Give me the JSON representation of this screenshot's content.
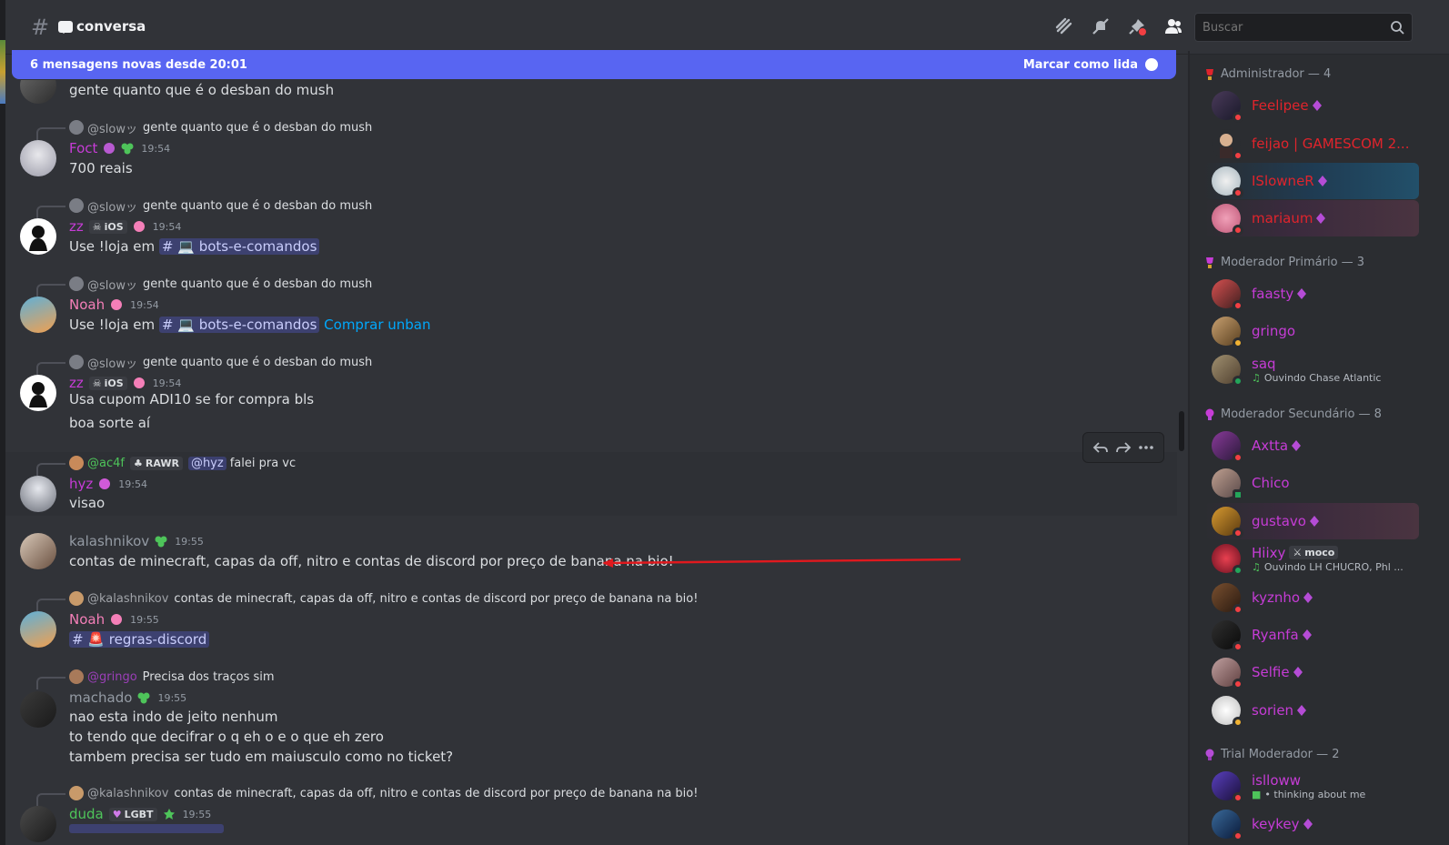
{
  "header": {
    "channel": "conversa",
    "search_placeholder": "Buscar"
  },
  "newbar": {
    "text": "6 mensagens novas desde 20:01",
    "mark_label": "Marcar como lida"
  },
  "messages": {
    "m0": {
      "text": "gente quanto que é o desban do mush"
    },
    "m1": {
      "reply_name": "@slowッ",
      "reply_text": "gente quanto que é o desban do mush",
      "user": "Foct",
      "time": "19:54",
      "text": "700 reais"
    },
    "m2": {
      "reply_name": "@slowッ",
      "reply_text": "gente quanto que é o desban do mush",
      "user": "zz",
      "tag": "iOS",
      "time": "19:54",
      "text_pre": "Use !loja em",
      "mention": "# 💻 bots-e-comandos"
    },
    "m3": {
      "reply_name": "@slowッ",
      "reply_text": "gente quanto que é o desban do mush",
      "user": "Noah",
      "time": "19:54",
      "text_pre": "Use !loja em",
      "mention": "# 💻 bots-e-comandos",
      "link": "Comprar unban"
    },
    "m4": {
      "reply_name": "@slowッ",
      "reply_text": "gente quanto que é o desban do mush",
      "user": "zz",
      "tag": "iOS",
      "time": "19:54",
      "line1": "Usa cupom ADI10 se for compra bls",
      "line2": "boa sorte aí"
    },
    "m5": {
      "reply_name": "@ac4f",
      "reply_tag": "RAWR",
      "reply_mention": "@hyz",
      "reply_text": "falei pra vc",
      "user": "hyz",
      "time": "19:54",
      "text": "visao"
    },
    "m6": {
      "user": "kalashnikov",
      "time": "19:55",
      "text": "contas de minecraft, capas da off, nitro e contas de discord por preço de banana na bio!"
    },
    "m7": {
      "reply_name": "@kalashnikov",
      "reply_text": "contas de minecraft, capas da off, nitro e contas de discord por preço de banana na bio!",
      "user": "Noah",
      "time": "19:55",
      "mention": "# 🚨 regras-discord"
    },
    "m8": {
      "reply_name": "@gringo",
      "reply_text": "Precisa dos traços sim",
      "user": "machado",
      "time": "19:55",
      "line1": "nao esta indo de jeito nenhum",
      "line2": "to tendo que decifrar o q eh o e o que eh zero",
      "line3": "tambem precisa ser tudo em maiusculo como no ticket?"
    },
    "m9": {
      "reply_name": "@kalashnikov",
      "reply_text": "contas de minecraft, capas da off, nitro e contas de discord por preço de banana na bio!",
      "user": "duda",
      "tag": "LGBT",
      "time": "19:55"
    }
  },
  "members": {
    "groups": {
      "admin": "Administrador — 4",
      "modp": "Moderador Primário — 3",
      "mods": "Moderador Secundário — 8",
      "trial": "Trial Moderador — 2"
    },
    "list": {
      "feelipee": "Feelipee",
      "feijao": "feijao | GAMESCOM 2...",
      "islowner": "ISlowneR",
      "mariaum": "mariaum",
      "faasty": "faasty",
      "gringo": "gringo",
      "saq": "saq",
      "saq_status": "Ouvindo Chase Atlantic",
      "axtta": "Axtta",
      "chico": "Chico",
      "gustavo": "gustavo",
      "hiixy": "Hiixy",
      "hiixy_tag": "moco",
      "hiixy_status": "Ouvindo LH CHUCRO, Phl ...",
      "kyznho": "kyznho",
      "ryanfa": "Ryanfa",
      "selfie": "Selfie",
      "sorien": "sorien",
      "islloww": "islloww",
      "islloww_status": "• thinking about me",
      "keykey": "keykey"
    }
  }
}
